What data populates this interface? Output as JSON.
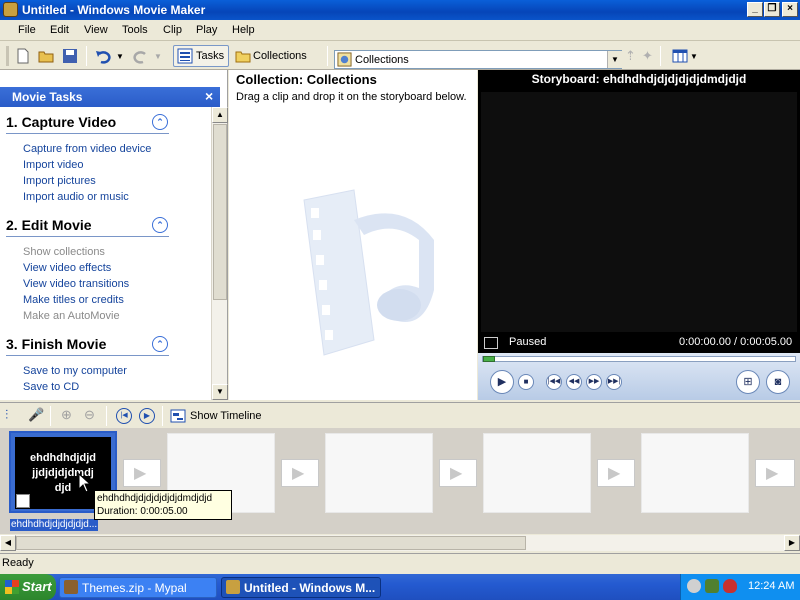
{
  "window": {
    "title": "Untitled - Windows Movie Maker"
  },
  "menu": [
    "File",
    "Edit",
    "View",
    "Tools",
    "Clip",
    "Play",
    "Help"
  ],
  "toolbar": {
    "tasks_label": "Tasks",
    "collections_label": "Collections",
    "collections_combo_value": "Collections"
  },
  "tasks": {
    "header": "Movie Tasks",
    "sections": [
      {
        "title": "1. Capture Video",
        "items": [
          {
            "label": "Capture from video device",
            "disabled": false
          },
          {
            "label": "Import video",
            "disabled": false
          },
          {
            "label": "Import pictures",
            "disabled": false
          },
          {
            "label": "Import audio or music",
            "disabled": false
          }
        ]
      },
      {
        "title": "2. Edit Movie",
        "items": [
          {
            "label": "Show collections",
            "disabled": true
          },
          {
            "label": "View video effects",
            "disabled": false
          },
          {
            "label": "View video transitions",
            "disabled": false
          },
          {
            "label": "Make titles or credits",
            "disabled": false
          },
          {
            "label": "Make an AutoMovie",
            "disabled": true
          }
        ]
      },
      {
        "title": "3. Finish Movie",
        "items": [
          {
            "label": "Save to my computer",
            "disabled": false
          },
          {
            "label": "Save to CD",
            "disabled": false
          }
        ]
      }
    ]
  },
  "collection": {
    "title": "Collection: Collections",
    "hint": "Drag a clip and drop it on the storyboard below."
  },
  "preview": {
    "title": "Storyboard: ehdhdhdjdjdjdjdjdmdjdjd",
    "status": "Paused",
    "time": "0:00:00.00 / 0:00:05.00",
    "progress": 0.0
  },
  "timeline": {
    "show_timeline_label": "Show Timeline"
  },
  "storyboard": {
    "clip_lines": [
      "ehdhdhdjdjd",
      "jjdjdjdjdmdj",
      "djd"
    ],
    "clip_caption": "ehdhdhdjdjdjdjdjd...",
    "tooltip_name": "ehdhdhdjdjdjdjdjdjdmdjdjd",
    "tooltip_duration": "Duration:  0:00:05.00"
  },
  "status": {
    "text": "Ready"
  },
  "taskbar": {
    "start": "Start",
    "buttons": [
      "Themes.zip - Mypal",
      "Untitled - Windows M..."
    ],
    "clock": "12:24 AM"
  },
  "colors": {
    "accent": "#2a5cc8",
    "link": "#15449c",
    "titlebar": "#0a5fd8"
  }
}
